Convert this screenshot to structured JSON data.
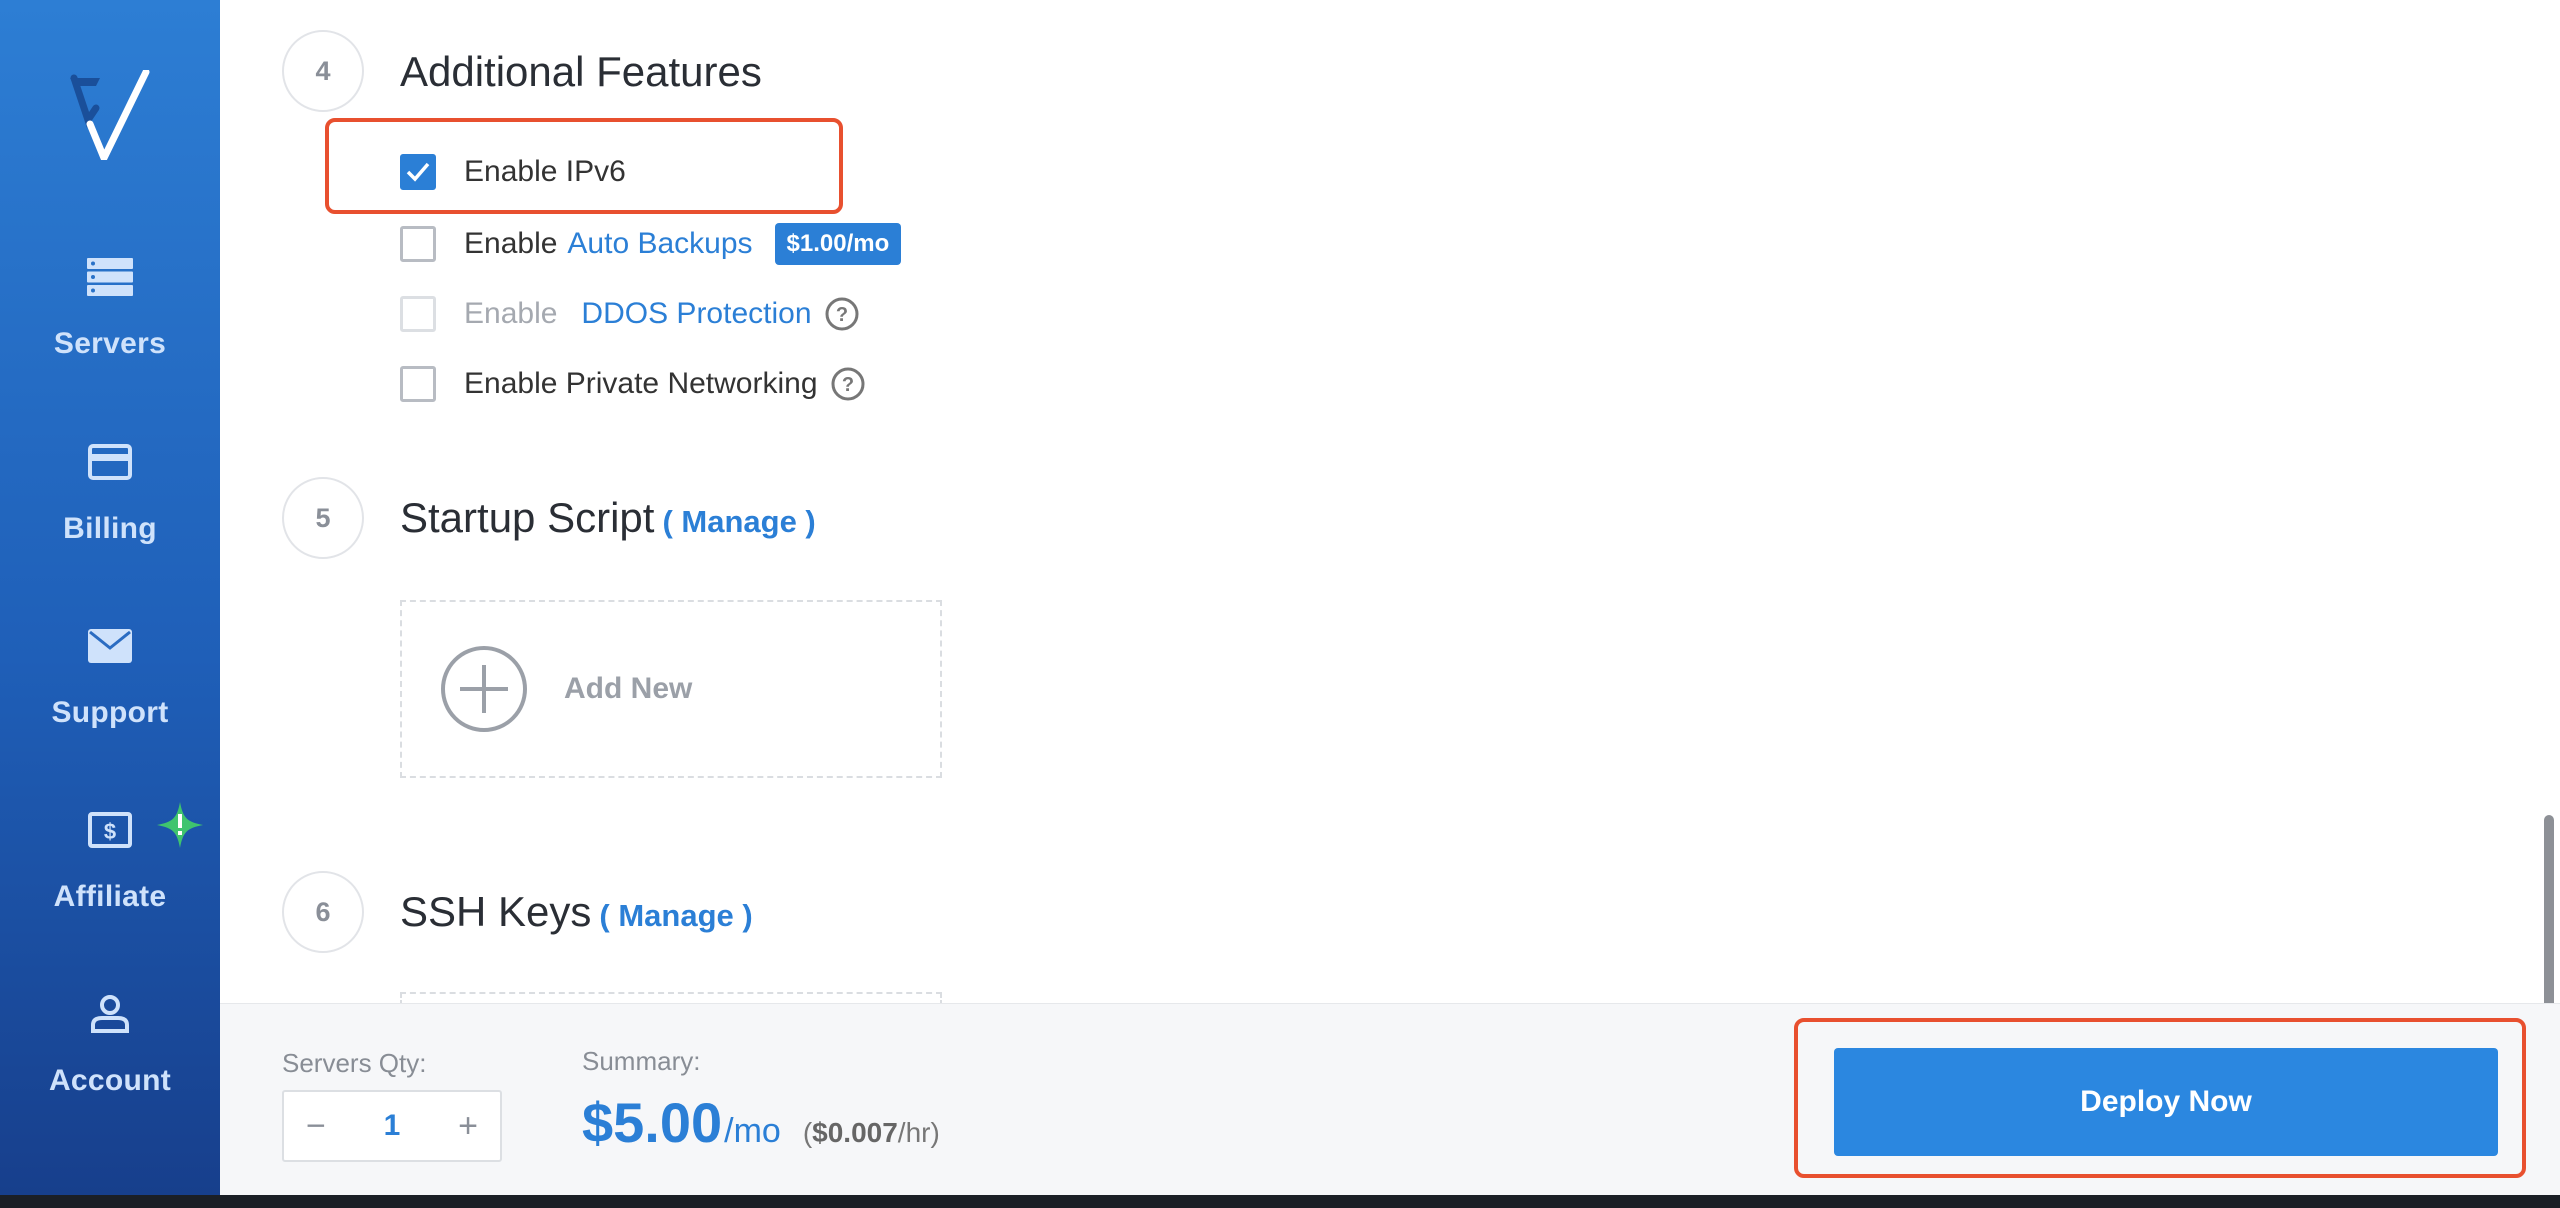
{
  "sidebar": {
    "items": [
      {
        "label": "Servers",
        "icon": "servers-icon"
      },
      {
        "label": "Billing",
        "icon": "credit-card-icon"
      },
      {
        "label": "Support",
        "icon": "envelope-icon"
      },
      {
        "label": "Affiliate",
        "icon": "dollar-icon"
      },
      {
        "label": "Account",
        "icon": "user-icon"
      }
    ]
  },
  "sections": {
    "features": {
      "number": "4",
      "title": "Additional Features",
      "options": [
        {
          "prefix": "Enable IPv6",
          "checked": true
        },
        {
          "prefix": "Enable",
          "link": "Auto Backups",
          "price": "$1.00/mo",
          "checked": false
        },
        {
          "prefix": "Enable",
          "link": "DDOS Protection",
          "checked": false,
          "disabled": true
        },
        {
          "prefix": "Enable Private Networking",
          "checked": false
        }
      ]
    },
    "startup": {
      "number": "5",
      "title": "Startup Script",
      "manage": "( Manage )",
      "add_new": "Add New"
    },
    "ssh": {
      "number": "6",
      "title": "SSH Keys",
      "manage": "( Manage )"
    }
  },
  "footer": {
    "qty_label": "Servers Qty:",
    "qty_minus": "−",
    "qty_value": "1",
    "qty_plus": "+",
    "summary_label": "Summary:",
    "price": "$5.00",
    "price_period": "/mo",
    "hourly_open": "(",
    "hourly_value": "$0.007",
    "hourly_close": "/hr)",
    "deploy_label": "Deploy Now"
  },
  "colors": {
    "accent": "#2b7fd6",
    "highlight": "#e8502f",
    "sidebar": "#2d7ed4"
  }
}
